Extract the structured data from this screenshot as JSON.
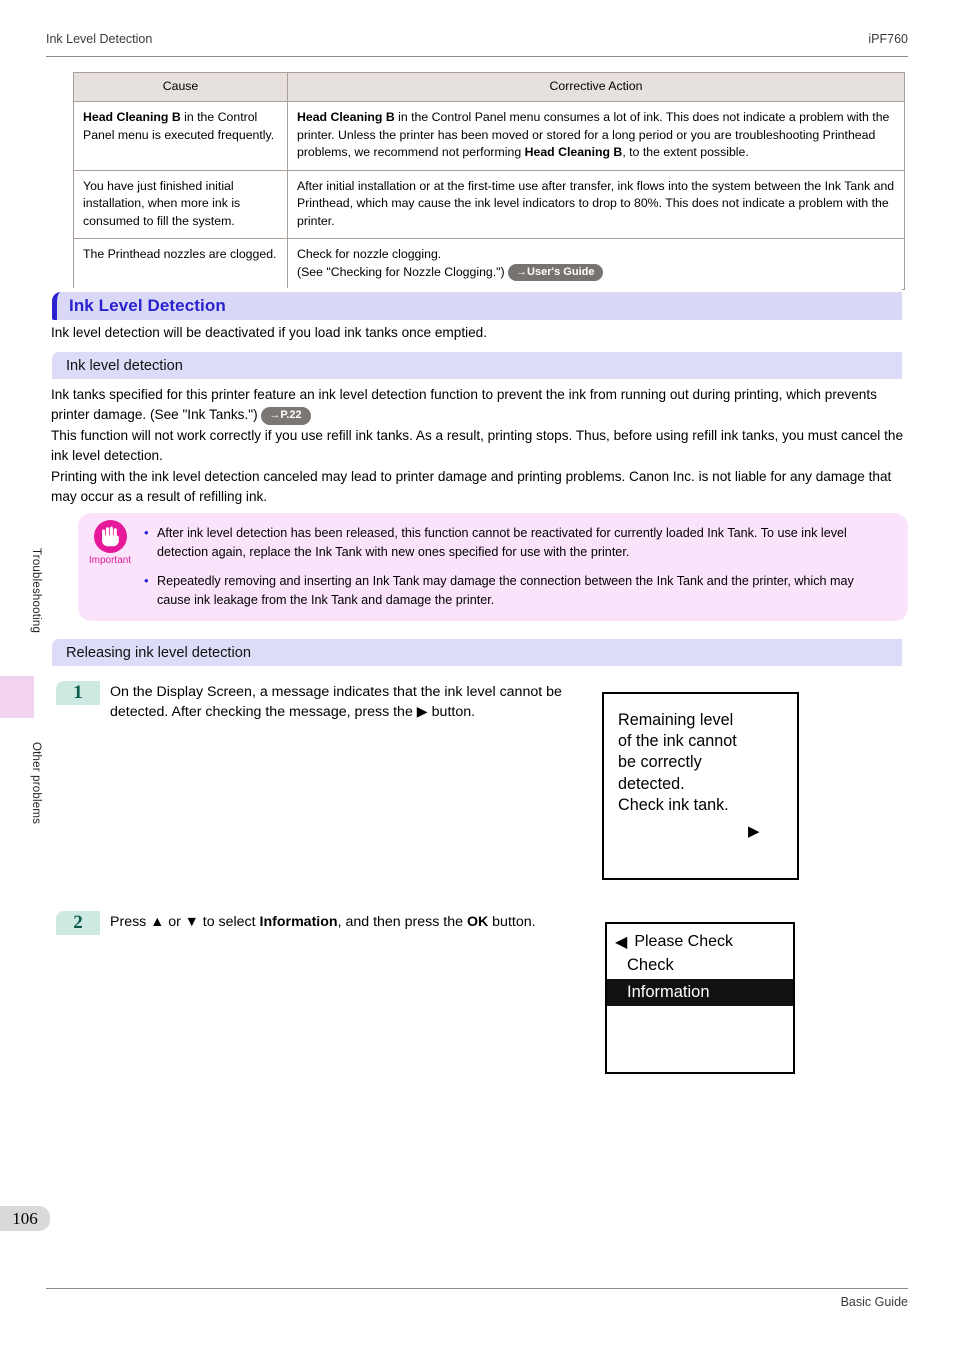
{
  "header": {
    "left_title": "Ink Level Detection",
    "right_model": "iPF760"
  },
  "side_rail": {
    "tab_upper": "Troubleshooting",
    "tab_lower": "Other problems",
    "tab_color": "#f2d4f0"
  },
  "cause_table": {
    "columns": [
      "Cause",
      "Corrective Action"
    ],
    "rows": [
      {
        "cause_strong": "Head Cleaning B",
        "cause_rest": " in the Control Panel menu is executed frequently.",
        "action_parts": [
          {
            "bold": "Head Cleaning B"
          },
          {
            "text": " in the Control Panel menu consumes a lot of ink. This does not indicate a problem with the printer. Unless the printer has been moved or stored for a long period or you are troubleshooting Printhead problems, we recommend not performing "
          },
          {
            "bold": "Head Cleaning B"
          },
          {
            "text": ", to the extent possible."
          }
        ]
      },
      {
        "cause_rest": "You have just finished initial installation, when more ink is consumed to fill the system.",
        "action_parts": [
          {
            "text": "After initial installation or at the first-time use after transfer, ink flows into the system between the Ink Tank and Printhead, which may cause the ink level indicators to drop to 80%. This does not indicate a problem with the printer."
          }
        ]
      },
      {
        "cause_rest": "The Printhead nozzles are clogged.",
        "action_line1": "Check for nozzle clogging.",
        "action_line2": " (See \"Checking for Nozzle Clogging.\") ",
        "action_badge": "→User's Guide"
      }
    ]
  },
  "section": {
    "heading": "Ink Level Detection",
    "heading_color": "#2a22cf",
    "intro": "Ink level detection will be deactivated if you load ink tanks once emptied."
  },
  "ink_level_detection": {
    "heading": "Ink level detection",
    "para1_before": "Ink tanks specified for this printer feature an ink level detection function to prevent the ink from running out during printing, which prevents printer damage.  (See \"Ink Tanks.\") ",
    "para1_badge": "→P.22",
    "para2": "This function will not work correctly if you use refill ink tanks. As a result, printing stops. Thus, before using refill ink tanks, you must cancel the ink level detection.",
    "para3": "Printing with the ink level detection canceled may lead to printer damage and printing problems. Canon Inc. is not liable for any damage that may occur as a result of refilling ink."
  },
  "important": {
    "label": "Important",
    "accent_color": "#e5199a",
    "background": "#fbe4fb",
    "bullets": [
      "After ink level detection has been released, this function cannot be reactivated for currently loaded Ink Tank. To use ink level detection again, replace the Ink Tank with new ones specified for use with the printer.",
      "Repeatedly removing and inserting an Ink Tank may damage the connection between the Ink Tank and the printer, which may cause ink leakage from the Ink Tank and damage the printer."
    ]
  },
  "releasing": {
    "heading": "Releasing ink level detection",
    "steps": [
      {
        "number": "1",
        "text_before": "On the Display Screen, a message indicates that the ink level cannot be detected. After checking the message, press the ",
        "text_after": " button."
      },
      {
        "number": "2",
        "text_press": "Press ",
        "up_arrow": "▲",
        "text_or": " or ",
        "down_arrow": "▼",
        "text_select": " to select ",
        "bold_information": "Information",
        "text_then": ", and then press the ",
        "bold_ok": "OK",
        "text_end": " button."
      }
    ]
  },
  "lcd_message": {
    "lines": [
      "Remaining level",
      "of the ink cannot",
      "be correctly",
      "detected.",
      "Check ink tank."
    ],
    "arrow": "▶"
  },
  "lcd_menu": {
    "back_arrow": "◀",
    "title": "Please Check",
    "items": [
      {
        "label": "Check",
        "selected": false
      },
      {
        "label": "Information",
        "selected": true
      }
    ]
  },
  "footer": {
    "page_number": "106",
    "guide_name": "Basic Guide"
  }
}
